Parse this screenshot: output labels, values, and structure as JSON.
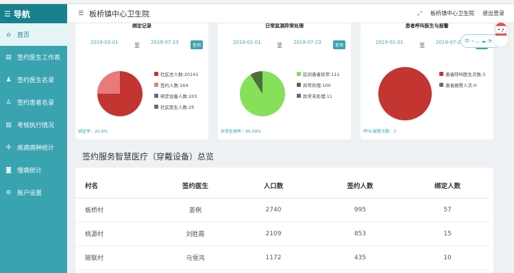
{
  "colors": {
    "teal": "#3aa3b0",
    "dark_teal": "#17818e",
    "red": "#c23531",
    "light_red": "#e97a7a",
    "green": "#86e05a",
    "dark_green": "#4e6e3a",
    "slate": "#5d6f83"
  },
  "sidebar": {
    "title": "导航",
    "title_icon": "menu-icon",
    "items": [
      {
        "label": "首页",
        "icon": "home-icon",
        "active": true
      },
      {
        "label": "签约医生工作表",
        "icon": "document-icon"
      },
      {
        "label": "签约医生名录",
        "icon": "user-icon"
      },
      {
        "label": "签约患者名录",
        "icon": "patient-icon"
      },
      {
        "label": "考核执行情况",
        "icon": "chart-icon"
      },
      {
        "label": "疾病病种统计",
        "icon": "stats-icon"
      },
      {
        "label": "慢病统计",
        "icon": "camera-icon"
      },
      {
        "label": "账户设置",
        "icon": "gear-icon"
      }
    ]
  },
  "topbar": {
    "title": "板桥镇中心卫生院",
    "user": "板桥镇中心卫生院",
    "logout": "退出登录"
  },
  "cards": [
    {
      "title": "绑定记录",
      "date_from": "2019-03-01",
      "date_to": "2019-07-23",
      "query": "查询",
      "legend": [
        "社区总人数:20141",
        "签约人数:164",
        "绑定设备人数:203",
        "社区医生人数:25"
      ],
      "footer": "绑定率：20.6%"
    },
    {
      "title": "日常监测异常处理",
      "date_from": "2019-01-01",
      "date_to": "2019-07-23",
      "query": "查询",
      "legend": [
        "区间患者异常:111",
        "异常处理:100",
        "异常未处理:11"
      ],
      "footer": "异常处理率：90.09%"
    },
    {
      "title": "患者呼叫医生与报警",
      "date_from": "2019-01-01",
      "date_to": "2019-07-23",
      "query": "查询",
      "legend": [
        "患者呼叫医生次数:3",
        "患者报警人次:0"
      ],
      "footer": "呼叫-报警次数：3"
    }
  ],
  "chart_data": [
    {
      "type": "pie",
      "labels": [
        "社区总人数",
        "签约人数",
        "绑定设备人数",
        "社区医生人数"
      ],
      "values": [
        20141,
        164,
        203,
        25
      ],
      "shown_slices": [
        0.74,
        0.26
      ],
      "colors": [
        "#c23531",
        "#e97a7a",
        "#5d6f83",
        "#5d6f83"
      ]
    },
    {
      "type": "pie",
      "labels": [
        "区间患者异常",
        "异常处理",
        "异常未处理"
      ],
      "values": [
        111,
        100,
        11
      ],
      "shown_slices": [
        0.9,
        0.1
      ],
      "colors": [
        "#86e05a",
        "#4e6e3a",
        "#5d6f83"
      ]
    },
    {
      "type": "pie",
      "labels": [
        "患者呼叫医生次数",
        "患者报警人次"
      ],
      "values": [
        3,
        0
      ],
      "colors": [
        "#c23531",
        "#5d6f83"
      ]
    }
  ],
  "section": {
    "title": "签约服务智慧医疗（穿戴设备）总览",
    "headers": [
      "村名",
      "签约医生",
      "人口数",
      "签约人数",
      "绑定人数"
    ],
    "rows": [
      [
        "板桥村",
        "姜俐",
        "2740",
        "995",
        "57"
      ],
      [
        "桃源村",
        "刘胜霞",
        "2109",
        "853",
        "15"
      ],
      [
        "陂联村",
        "马雪鸿",
        "1172",
        "435",
        "10"
      ]
    ]
  },
  "widget": {
    "label": "中 ∘ ◡ ☁ ◔"
  }
}
